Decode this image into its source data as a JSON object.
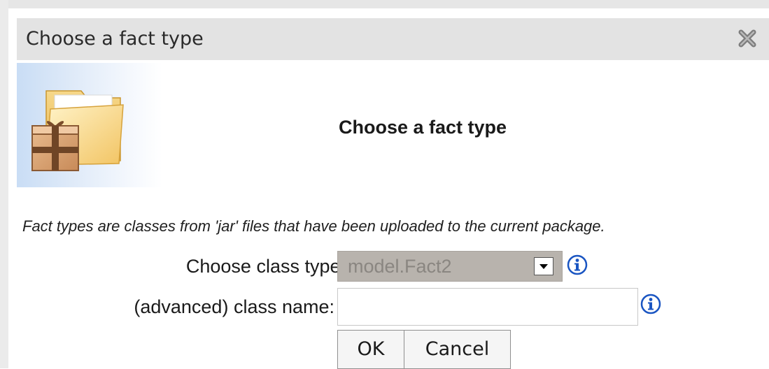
{
  "dialog": {
    "title": "Choose a fact type",
    "close_icon": "close-icon",
    "image_icon": "fact-package-folder-icon",
    "heading": "Choose a fact type",
    "description": "Fact types are classes from 'jar' files that have been uploaded to the current package.",
    "choose_class_label": "Choose class type:",
    "choose_class_value": "model.Fact2",
    "class_name_label": "(advanced) class name:",
    "class_name_value": "",
    "info_icon": "info-icon",
    "ok_label": "OK",
    "cancel_label": "Cancel"
  },
  "colors": {
    "title_bar": "#e3e3e3",
    "select_bg": "#b8b3ad",
    "info_blue": "#1a55c2"
  }
}
